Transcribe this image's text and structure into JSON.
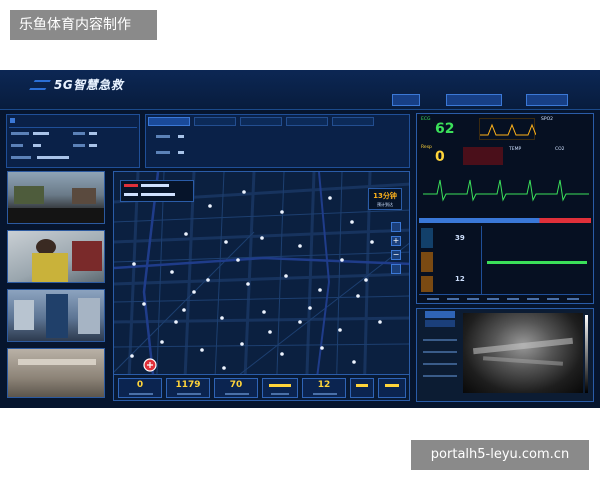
{
  "watermark": {
    "top": "乐鱼体育内容制作",
    "bottom": "portalh5-leyu.com.cn"
  },
  "header": {
    "title": "5G智慧急救"
  },
  "map": {
    "eta_value": "13分钟",
    "eta_caption": "预计到达"
  },
  "stats": [
    {
      "value": "0"
    },
    {
      "value": "1179"
    },
    {
      "value": "70"
    },
    {
      "value": "12"
    }
  ],
  "monitor": {
    "ecg_label": "ECG",
    "hr": "62",
    "spo2_label": "SPO2",
    "resp_label": "Resp",
    "resp": "0",
    "temp_label": "TEMP",
    "co2_label": "CO2",
    "nibp_value": "39",
    "sub_value": "12"
  },
  "colors": {
    "screen_bg": "#06152e",
    "panel_bg": "#0a2148",
    "accent_blue": "#2b6fd6",
    "hr_green": "#3be05a",
    "stat_yellow": "#ffd43a",
    "alert_red": "#e0303a",
    "eta_orange": "#ffb21a"
  }
}
